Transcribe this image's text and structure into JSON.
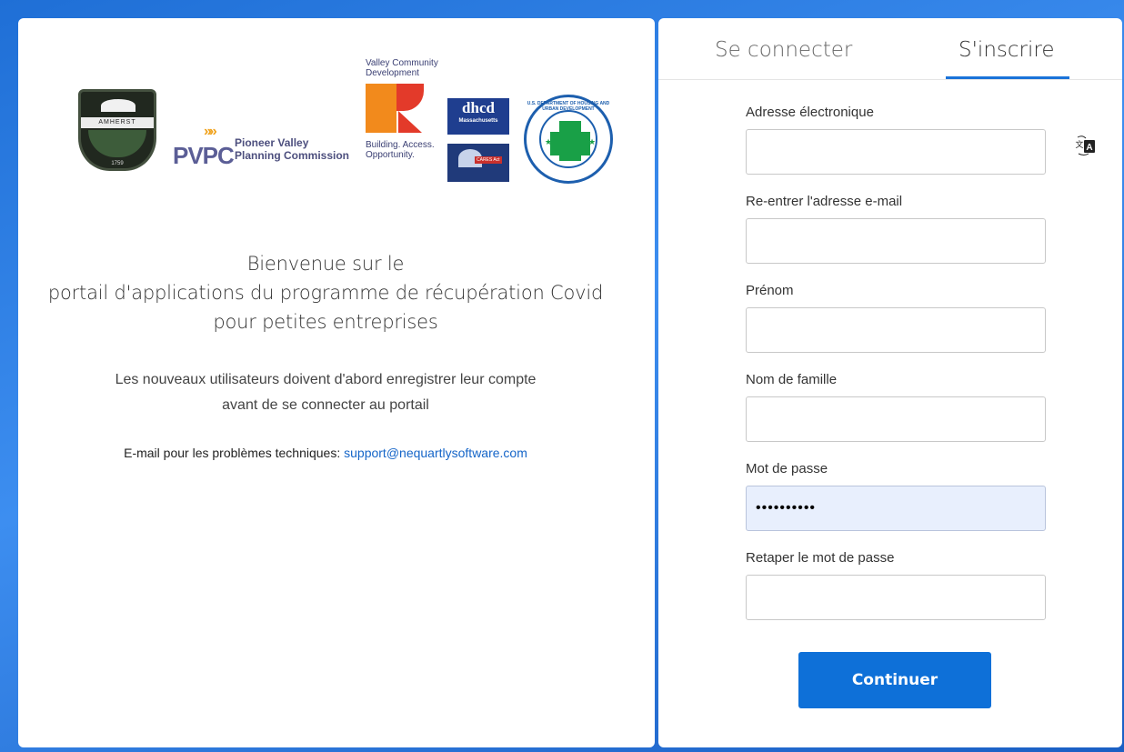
{
  "logos": {
    "amherst_band": "AMHERST",
    "amherst_year": "1759",
    "pvpc_mark": "PVPC",
    "pvpc_name": "Pioneer Valley\nPlanning Commission",
    "vcd_title": "Valley Community Development",
    "vcd_tagline": "Building. Access. Opportunity.",
    "dhcd_big": "dhcd",
    "dhcd_small": "Massachusetts",
    "cares_label": "CARES Act",
    "hud_ring": "U.S. DEPARTMENT OF HOUSING AND URBAN DEVELOPMENT"
  },
  "welcome": {
    "line1": "Bienvenue sur le",
    "line2": "portail d'applications du programme de récupération Covid",
    "line3": "pour petites entreprises"
  },
  "note": {
    "line1": "Les nouveaux utilisateurs doivent d'abord enregistrer leur compte",
    "line2": "avant de se connecter au portail"
  },
  "support": {
    "label": "E-mail pour les problèmes techniques:",
    "email": "support@nequartlysoftware.com"
  },
  "tabs": {
    "signin": "Se connecter",
    "signup": "S'inscrire",
    "active": "signup"
  },
  "form": {
    "email_label": "Adresse électronique",
    "email_value": "",
    "email_confirm_label": "Re-entrer l'adresse e-mail",
    "email_confirm_value": "",
    "first_name_label": "Prénom",
    "first_name_value": "",
    "last_name_label": "Nom de famille",
    "last_name_value": "",
    "password_label": "Mot de passe",
    "password_value": "••••••••••",
    "password_confirm_label": "Retaper le mot de passe",
    "password_confirm_value": "",
    "submit_label": "Continuer"
  },
  "icons": {
    "translate": "translate-icon"
  },
  "colors": {
    "accent": "#0e70d8",
    "link": "#1565c8",
    "background": "#2b7de0"
  }
}
